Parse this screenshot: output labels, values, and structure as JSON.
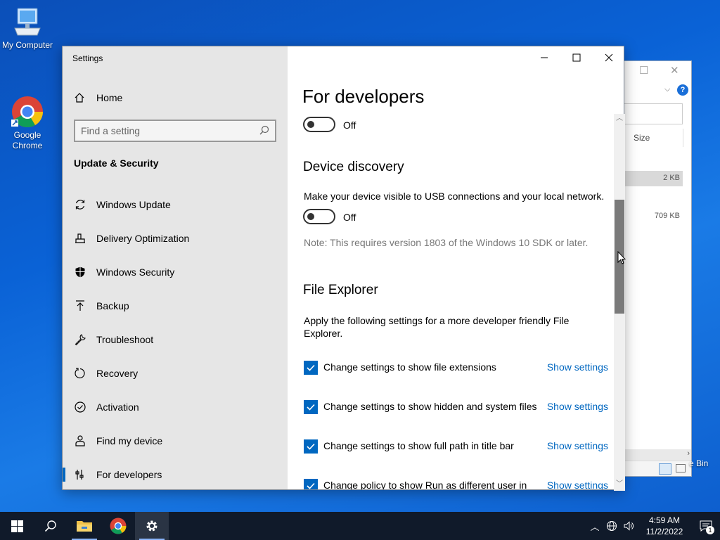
{
  "desktop": {
    "icons": [
      {
        "label": "My Computer"
      },
      {
        "label": "Google\nChrome"
      }
    ],
    "recycle_label": "e Bin"
  },
  "bg_explorer": {
    "col_size": "Size",
    "row1_size": "2 KB",
    "row2_size": "709 KB"
  },
  "window": {
    "title": "Settings",
    "sidebar": {
      "home": "Home",
      "search_placeholder": "Find a setting",
      "section_title": "Update & Security",
      "items": [
        {
          "label": "Windows Update",
          "icon": "refresh-icon"
        },
        {
          "label": "Delivery Optimization",
          "icon": "delivery-icon"
        },
        {
          "label": "Windows Security",
          "icon": "shield-icon"
        },
        {
          "label": "Backup",
          "icon": "backup-arrow-icon"
        },
        {
          "label": "Troubleshoot",
          "icon": "wrench-icon"
        },
        {
          "label": "Recovery",
          "icon": "recovery-icon"
        },
        {
          "label": "Activation",
          "icon": "check-circle-icon"
        },
        {
          "label": "Find my device",
          "icon": "person-pin-icon"
        },
        {
          "label": "For developers",
          "icon": "developer-icon",
          "active": true
        }
      ]
    },
    "main": {
      "page_title": "For developers",
      "dev_mode_toggle": {
        "state": "Off"
      },
      "device_discovery": {
        "heading": "Device discovery",
        "description": "Make your device visible to USB connections and your local network.",
        "toggle_state": "Off",
        "note": "Note: This requires version 1803 of the Windows 10 SDK or later."
      },
      "file_explorer": {
        "heading": "File Explorer",
        "description": "Apply the following settings for a more developer friendly File Explorer.",
        "options": [
          {
            "label": "Change settings to show file extensions",
            "checked": true,
            "link": "Show settings"
          },
          {
            "label": "Change settings to show hidden and system files",
            "checked": true,
            "link": "Show settings"
          },
          {
            "label": "Change settings to show full path in title bar",
            "checked": true,
            "link": "Show settings"
          },
          {
            "label": "Change policy to show Run as different user in",
            "checked": true,
            "link": "Show settings"
          }
        ]
      }
    }
  },
  "taskbar": {
    "time": "4:59 AM",
    "date": "11/2/2022",
    "notification_count": "1"
  },
  "colors": {
    "accent": "#0067c0",
    "taskbar": "#101a2a",
    "sidebar": "#e6e6e6"
  }
}
